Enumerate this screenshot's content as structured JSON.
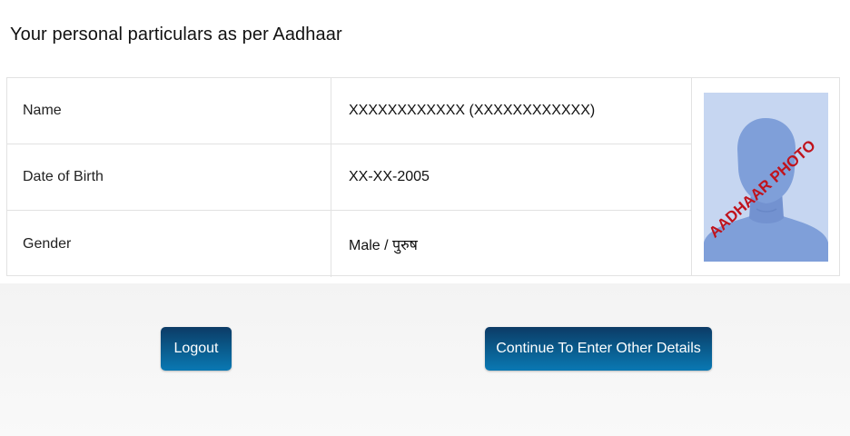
{
  "page": {
    "title": "Your personal particulars as per Aadhaar"
  },
  "particulars": {
    "rows": [
      {
        "label": "Name",
        "value": "XXXXXXXXXXXX (XXXXXXXXXXXX)"
      },
      {
        "label": "Date of Birth",
        "value": "XX-XX-2005"
      },
      {
        "label": "Gender",
        "value": "Male / पुरुष"
      }
    ],
    "photo": {
      "watermark": "AADHAAR PHOTO",
      "watermark_color": "#c0131c",
      "background_color": "#c6d6f1",
      "silhouette_color": "#7f9fd9"
    }
  },
  "actions": {
    "logout_label": "Logout",
    "continue_label": "Continue To Enter Other Details",
    "button_color": "#0a5888"
  }
}
